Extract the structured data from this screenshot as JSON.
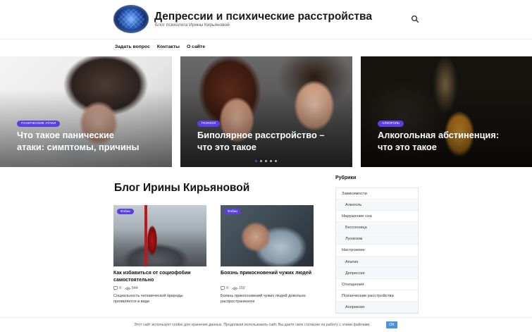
{
  "header": {
    "site_title": "Депрессии и психические расстройства",
    "site_subtitle": "Блог психолога Ирины Кирьяновой"
  },
  "nav": {
    "items": [
      "Задать вопрос",
      "Контакты",
      "О сайте"
    ]
  },
  "slider": {
    "slides": [
      {
        "tag": "Панические атаки",
        "title_line1": "Что такое панические",
        "title_line2": "атаки: симптомы, причины"
      },
      {
        "tag": "Психоз",
        "title_line1": "Биполярное расстройство –",
        "title_line2": "что это такое"
      },
      {
        "tag": "Алкоголь",
        "title_line1": "Алкогольная абстиненция:",
        "title_line2": "что это такое"
      }
    ],
    "active_dot": 1,
    "dot_count": 5
  },
  "blog": {
    "heading": "Блог Ирины Кирьяновой",
    "cards": [
      {
        "tag": "Фобии",
        "title": "Как избавиться от социофобии самостоятельно",
        "comments": "0",
        "views": "544",
        "excerpt": "Социальность человеческой природы проявляется в виде"
      },
      {
        "tag": "Фобии",
        "title": "Боязнь прикосновений чужих людей",
        "comments": "0",
        "views": "192",
        "excerpt": "Боязнь прикосновений чужих людей довольно распространенное"
      }
    ]
  },
  "sidebar": {
    "title": "Рубрики",
    "categories": [
      {
        "label": "Зависимости",
        "sub": false
      },
      {
        "label": "Алкоголь",
        "sub": true
      },
      {
        "label": "Нарушение сна",
        "sub": false
      },
      {
        "label": "Бессонница",
        "sub": true
      },
      {
        "label": "Лунатизм",
        "sub": true
      },
      {
        "label": "Настроение",
        "sub": false
      },
      {
        "label": "Апатия",
        "sub": true
      },
      {
        "label": "Депрессия",
        "sub": true
      },
      {
        "label": "Отношения",
        "sub": false
      },
      {
        "label": "Психические расстройства",
        "sub": false
      },
      {
        "label": "Анорексия",
        "sub": true
      }
    ]
  },
  "cookie": {
    "text": "Этот сайт использует cookie для хранения данных. Продолжая использовать сайт, Вы даете свое согласие на работу с этими файлами.",
    "ok_label": "OK"
  },
  "colors": {
    "accent": "#5b3fe0",
    "ok_button": "#4a8fe0"
  }
}
